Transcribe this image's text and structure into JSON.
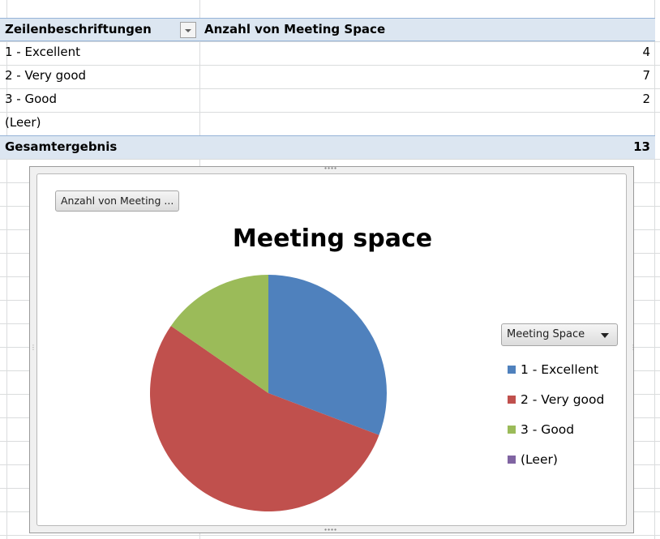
{
  "pivot": {
    "header": {
      "row_label": "Zeilenbeschriftungen",
      "value_label": "Anzahl von Meeting Space"
    },
    "rows": [
      {
        "label": "1 - Excellent",
        "value": "4"
      },
      {
        "label": "2 - Very good",
        "value": "7"
      },
      {
        "label": "3 - Good",
        "value": "2"
      },
      {
        "label": "(Leer)",
        "value": ""
      }
    ],
    "total": {
      "label": "Gesamtergebnis",
      "value": "13"
    }
  },
  "chart": {
    "field_button": "Anzahl von Meeting ...",
    "legend_button": "Meeting Space"
  },
  "chart_data": {
    "type": "pie",
    "title": "Meeting space",
    "categories": [
      "1 - Excellent",
      "2 - Very good",
      "3 - Good",
      "(Leer)"
    ],
    "values": [
      4,
      7,
      2,
      0
    ],
    "colors": [
      "#4f81bd",
      "#c0504d",
      "#9bbb59",
      "#8064a2"
    ],
    "legend": "right"
  }
}
